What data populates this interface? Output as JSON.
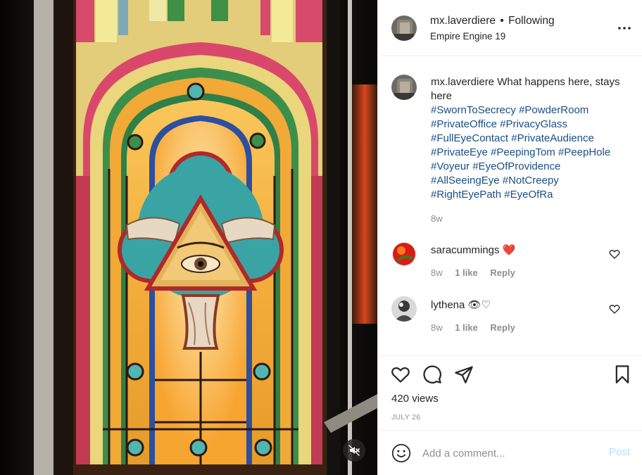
{
  "post": {
    "username": "mx.laverdiere",
    "separator": "•",
    "follow_state": "Following",
    "subtitle": "Empire Engine 19"
  },
  "caption": {
    "username": "mx.laverdiere",
    "text": "What happens here, stays here",
    "hashtags": [
      "#SwornToSecrecy",
      "#PowderRoom",
      "#PrivateOffice",
      "#PrivacyGlass",
      "#FullEyeContact",
      "#PrivateAudience",
      "#PrivateEye",
      "#PeepingTom",
      "#PeepHole",
      "#Voyeur",
      "#EyeOfProvidence",
      "#AllSeeingEye",
      "#NotCreepy",
      "#RightEyePath",
      "#EyeOfRa"
    ],
    "time": "8w"
  },
  "comments": [
    {
      "username": "saracummings",
      "text": "❤️",
      "time": "8w",
      "likes": "1 like",
      "reply": "Reply"
    },
    {
      "username": "lythena",
      "text": "👁♡",
      "time": "8w",
      "likes": "1 like",
      "reply": "Reply"
    }
  ],
  "stats": {
    "views": "420 views",
    "date": "JULY 26"
  },
  "composer": {
    "placeholder": "Add a comment...",
    "post_label": "Post"
  },
  "icons": {
    "more": "more-options-icon",
    "like": "heart-icon",
    "comment": "comment-bubble-icon",
    "share": "paper-plane-icon",
    "save": "bookmark-icon",
    "emoji": "smiley-icon",
    "mute": "speaker-muted-icon"
  },
  "colors": {
    "hashtag": "#1a4f84",
    "muted_text": "#8e8e8e",
    "post_disabled": "#b2dffc",
    "heart_red": "#ed4956"
  }
}
